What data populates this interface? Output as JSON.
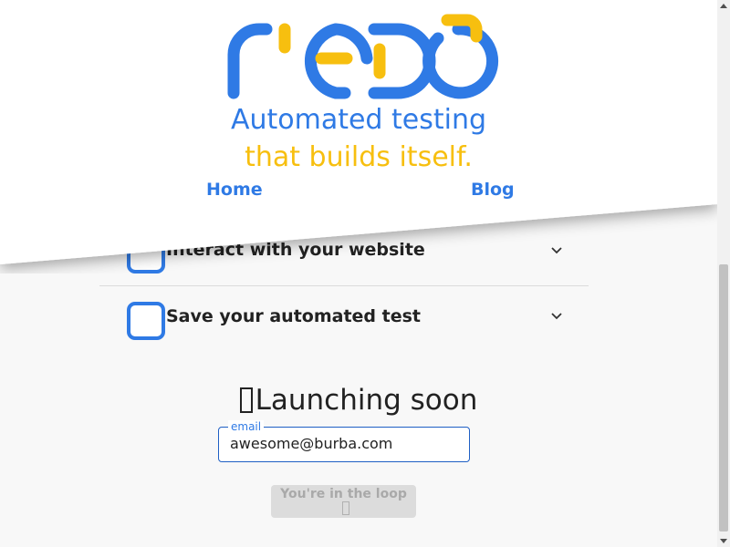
{
  "brand": {
    "logo_text": "redo",
    "tagline_line1": "Automated testing",
    "tagline_line2": "that builds itself.",
    "colors": {
      "blue": "#2f7ae5",
      "yellow": "#f7bf0f"
    }
  },
  "nav": {
    "home": "Home",
    "blog": "Blog"
  },
  "steps": [
    {
      "label": "Interact with your website",
      "icon": "chevron-down-icon"
    },
    {
      "label": "Save your automated test",
      "icon": "chevron-down-icon"
    }
  ],
  "launch": {
    "title": "Launching soon",
    "email_label": "email",
    "email_value": "awesome@burba.com",
    "submit_label": "You're in the loop"
  }
}
